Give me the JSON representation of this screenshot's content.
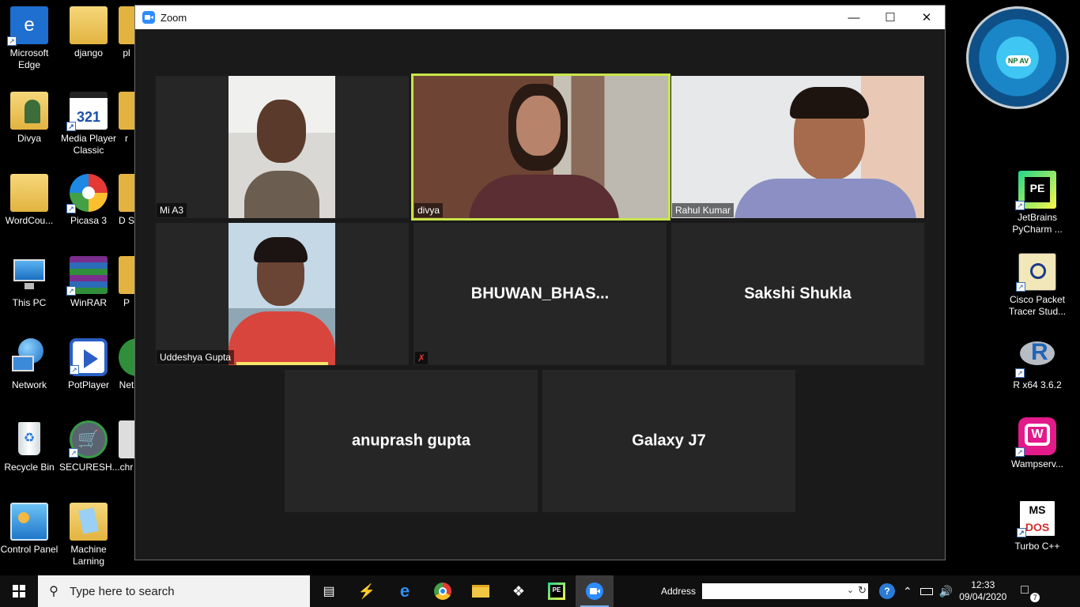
{
  "desktop": {
    "icons": [
      {
        "label": "Microsoft Edge",
        "icon": "edge-icon"
      },
      {
        "label": "django",
        "icon": "folder-icon"
      },
      {
        "label": "pl",
        "icon": "folder-icon"
      },
      {
        "label": "Divya",
        "icon": "user-folder-icon"
      },
      {
        "label": "Media Player Classic",
        "icon": "media-player-icon"
      },
      {
        "label": "r",
        "icon": "folder-icon"
      },
      {
        "label": "WordCou...",
        "icon": "folder-icon"
      },
      {
        "label": "Picasa 3",
        "icon": "picasa-icon"
      },
      {
        "label": "D S",
        "icon": "folder-icon"
      },
      {
        "label": "This PC",
        "icon": "computer-icon"
      },
      {
        "label": "WinRAR",
        "icon": "winrar-icon"
      },
      {
        "label": "P",
        "icon": "folder-icon"
      },
      {
        "label": "Network",
        "icon": "network-icon"
      },
      {
        "label": "PotPlayer",
        "icon": "potplayer-icon"
      },
      {
        "label": "Net",
        "icon": "app-icon"
      },
      {
        "label": "Recycle Bin",
        "icon": "recycle-bin-icon"
      },
      {
        "label": "SECURESH...",
        "icon": "secureshop-icon"
      },
      {
        "label": "chr",
        "icon": "app-icon"
      },
      {
        "label": "Control Panel",
        "icon": "control-panel-icon"
      },
      {
        "label": "Machine Larning",
        "icon": "folder-icon"
      },
      {
        "label": "JetBrains PyCharm ...",
        "icon": "pycharm-icon"
      },
      {
        "label": "Cisco Packet Tracer Stud...",
        "icon": "packet-tracer-icon"
      },
      {
        "label": "R x64 3.6.2",
        "icon": "r-language-icon"
      },
      {
        "label": "Wampserv...",
        "icon": "wampserver-icon"
      },
      {
        "label": "Turbo C++",
        "icon": "turbo-cpp-icon"
      }
    ],
    "npav_logo": "NP AV"
  },
  "zoom": {
    "title": "Zoom",
    "participants": [
      {
        "name": "Mi A3",
        "video": true
      },
      {
        "name": "divya",
        "video": true,
        "active_speaker": true
      },
      {
        "name": "Rahul Kumar",
        "video": true
      },
      {
        "name": "Uddeshya Gupta",
        "video": true
      },
      {
        "name": "BHUWAN_BHAS...",
        "video": false,
        "muted": true
      },
      {
        "name": "Sakshi Shukla",
        "video": false
      },
      {
        "name": "anuprash gupta",
        "video": false
      },
      {
        "name": "Galaxy J7",
        "video": false
      }
    ]
  },
  "taskbar": {
    "search_placeholder": "Type here to search",
    "address_label": "Address",
    "time": "12:33",
    "date": "09/04/2020",
    "notification_count": "7"
  },
  "colors": {
    "active_speaker_border": "#c8e64a",
    "tile_bg": "#262626",
    "zoom_blue": "#2d8cff"
  }
}
